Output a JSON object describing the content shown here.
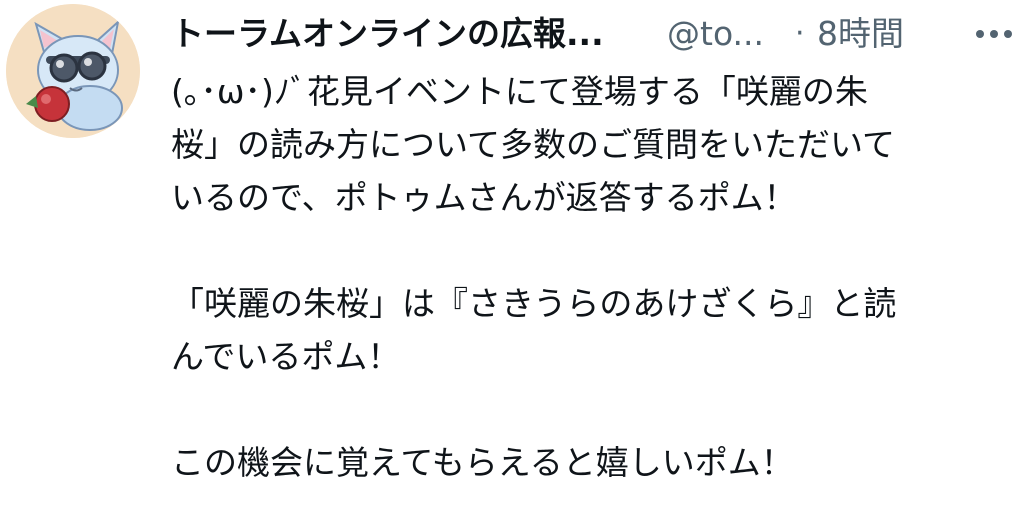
{
  "tweet": {
    "author": {
      "display_name": "トーラムオンラインの広報...",
      "handle": "@to...",
      "avatar_icon": "mascot-avatar-icon"
    },
    "separator": "·",
    "timestamp": "8時間",
    "more_icon": "more-options-icon",
    "body_lines": [
      "(｡･ω･)ﾉﾞ花見イベントにて登場する「咲麗の朱",
      "桜」の読み方について多数のご質問をいただいて",
      "いるので、ポトゥムさんが返答するポム！",
      "",
      "「咲麗の朱桜」は『さきうらのあけざくら』と読",
      "んでいるポム！",
      "",
      "この機会に覚えてもらえると嬉しいポム！"
    ]
  },
  "colors": {
    "text_primary": "#0f1419",
    "text_secondary": "#536471",
    "avatar_background": "#f5dfc2"
  }
}
